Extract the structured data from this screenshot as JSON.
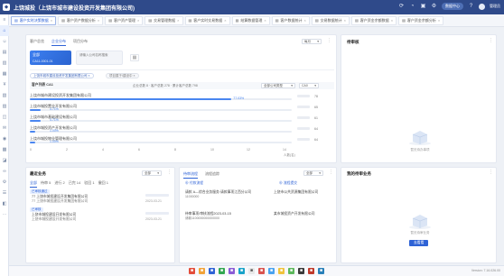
{
  "app": {
    "title": "上饶城投（上饶市城市建设投资开发集团有限公司)",
    "logo": "◆"
  },
  "topbar": {
    "badge": "数据中心",
    "user": "管理员"
  },
  "tabs": [
    {
      "label": "客户实时决策数据"
    },
    {
      "label": "客户资产数据分析"
    },
    {
      "label": "客户资产管理"
    },
    {
      "label": "交易管理数据"
    },
    {
      "label": "客户实时交易数据"
    },
    {
      "label": "结算数据管理"
    },
    {
      "label": "客户数据统计"
    },
    {
      "label": "交易数据统计"
    },
    {
      "label": "客户资金余额数据"
    },
    {
      "label": "客户资金余额分析"
    }
  ],
  "main": {
    "subtabs": [
      "客户总览",
      "企业分布",
      "项目分布"
    ],
    "active_subtab": 1,
    "select_right": "每月",
    "card_blue": {
      "line1": "全部",
      "line2": "CA11-0001-01"
    },
    "card_grey": {
      "line1": "请输入公司名称搜索",
      "line2": ""
    },
    "chips": [
      "上饶市城市建设投资开发集团有限公司",
      "项目属于/建设中"
    ],
    "filter_label": "客户列表 CA1",
    "filter_stats": "企业总数 8 · 客户总数 278 · 累计客户总数 798",
    "select_company": "全部公司类型",
    "select_ca": "CA0",
    "rows": [
      {
        "name": "上饶市城市建设投资开发集团有限公司",
        "pct": 0.77,
        "label": "77.03%",
        "meta": "78"
      },
      {
        "name": "上饶市城投置业开发有限公司",
        "pct": 0.04,
        "label": "4.71%",
        "meta": "65"
      },
      {
        "name": "上饶市城市基础建设有限公司",
        "pct": 0.04,
        "label": "4.71%",
        "meta": "61"
      },
      {
        "name": "上饶市城投资产开发有限公司",
        "pct": 0.02,
        "label": "1.00%",
        "meta": "64"
      },
      {
        "name": "上饶市城投物业管理有限公司",
        "pct": 0.02,
        "label": "1.00%",
        "meta": "64"
      }
    ],
    "xticks": [
      "0",
      "2",
      "4",
      "6",
      "8",
      "10",
      "12",
      "14"
    ],
    "x_unit": "人数(名)"
  },
  "right_panel": {
    "title": "待审核",
    "empty": "暂无待办事项"
  },
  "bottom_left": {
    "title": "最近业务",
    "filter": "全部",
    "tabs": [
      "全部",
      "待审 5",
      "进行 2",
      "已完 14",
      "驳回 1",
      "撤回 1"
    ],
    "items": [
      {
        "tag": "已审核通过",
        "line1": "77 上饶市城投建设开发集团有限公司",
        "line2": "77 上饶市城投建设开发集团有限公司",
        "date": "2023-03-21"
      },
      {
        "tag": "已审核",
        "line1": "上饶市城投建设开发有限公司",
        "line2": "上饶市城投建设开发有限公司",
        "date": "2023-03-21"
      }
    ]
  },
  "bottom_mid": {
    "tabs": [
      "待审流程",
      "流程追踪"
    ],
    "filter": "全部",
    "sub": [
      "付款流程",
      "流程提交"
    ],
    "rows": [
      {
        "left": "请款 A—综合业务服务·请款事项江西分公司",
        "code": "11000000",
        "right": "上饶市公共资源集团有限公司"
      },
      {
        "left": "待审事项/审核流程2023-03-15",
        "code": "请款1100000000000000",
        "right": "某市城投资产开发有限公司"
      }
    ]
  },
  "bottom_right": {
    "title": "我的待审业务",
    "empty": "暂无待审业务",
    "button": "去看看"
  },
  "footer": {
    "version": "Version: 7.16.026.00"
  }
}
